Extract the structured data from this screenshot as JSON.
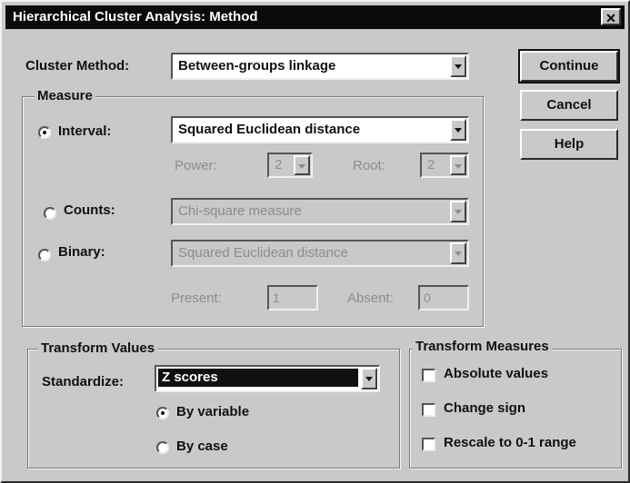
{
  "window": {
    "title": "Hierarchical Cluster Analysis: Method",
    "close_glyph": "✕"
  },
  "cluster_method": {
    "label": "Cluster Method:",
    "value": "Between-groups linkage"
  },
  "buttons": {
    "continue": "Continue",
    "cancel": "Cancel",
    "help": "Help"
  },
  "measure": {
    "title": "Measure",
    "interval": {
      "label": "Interval:",
      "value": "Squared Euclidean distance",
      "selected": true
    },
    "power": {
      "label": "Power:",
      "value": "2"
    },
    "root": {
      "label": "Root:",
      "value": "2"
    },
    "counts": {
      "label": "Counts:",
      "value": "Chi-square measure",
      "selected": false
    },
    "binary": {
      "label": "Binary:",
      "value": "Squared Euclidean distance",
      "selected": false
    },
    "present": {
      "label": "Present:",
      "value": "1"
    },
    "absent": {
      "label": "Absent:",
      "value": "0"
    }
  },
  "transform_values": {
    "title": "Transform Values",
    "standardize": {
      "label": "Standardize:",
      "value": "Z scores"
    },
    "by_variable": {
      "label": "By variable",
      "selected": true
    },
    "by_case": {
      "label": "By case",
      "selected": false
    }
  },
  "transform_measures": {
    "title": "Transform Measures",
    "absolute_values": {
      "label": "Absolute values",
      "checked": false
    },
    "change_sign": {
      "label": "Change sign",
      "checked": false
    },
    "rescale": {
      "label": "Rescale to 0-1 range",
      "checked": false
    }
  }
}
